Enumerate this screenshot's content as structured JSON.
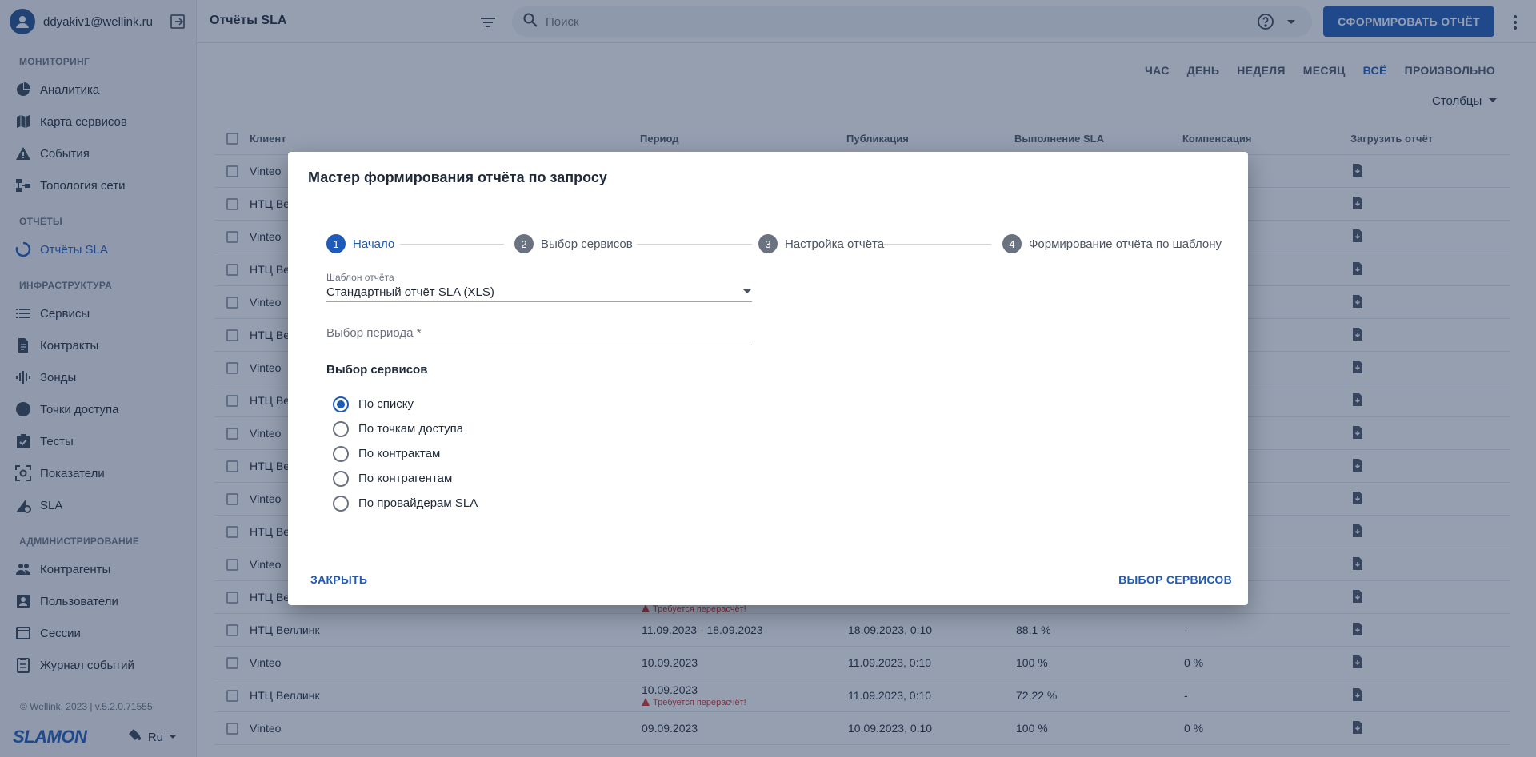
{
  "sidebar": {
    "user_email": "ddyakiv1@wellink.ru",
    "sections": {
      "monitoring": "МОНИТОРИНГ",
      "reports": "ОТЧЁТЫ",
      "infrastructure": "ИНФРАСТРУКТУРА",
      "administration": "АДМИНИСТРИРОВАНИЕ"
    },
    "items": {
      "analytics": "Аналитика",
      "service_map": "Карта сервисов",
      "events": "События",
      "topology": "Топология сети",
      "sla_reports": "Отчёты SLA",
      "services": "Сервисы",
      "contracts": "Контракты",
      "probes": "Зонды",
      "access_points": "Точки доступа",
      "tests": "Тесты",
      "indicators": "Показатели",
      "sla": "SLA",
      "counterparties": "Контрагенты",
      "users": "Пользователи",
      "sessions": "Сессии",
      "event_log": "Журнал событий"
    },
    "footer": "© Wellink, 2023 | v.5.2.0.71555",
    "logo": "SLAMON",
    "language": "Ru"
  },
  "header": {
    "title": "Отчёты SLA",
    "search_placeholder": "Поиск",
    "primary_button": "СФОРМИРОВАТЬ ОТЧЁТ"
  },
  "periods": [
    "ЧАС",
    "ДЕНЬ",
    "НЕДЕЛЯ",
    "МЕСЯЦ",
    "ВСЁ",
    "ПРОИЗВОЛЬНО"
  ],
  "active_period": "ВСЁ",
  "columns_button": "Столбцы",
  "table": {
    "headers": {
      "client": "Клиент",
      "period": "Период",
      "publication": "Публикация",
      "sla": "Выполнение SLA",
      "compensation": "Компенсация",
      "download": "Загрузить отчёт"
    },
    "hidden_rows": [
      "Vinteo",
      "НТЦ Ве",
      "Vinteo",
      "НТЦ Ве",
      "Vinteo",
      "НТЦ Ве",
      "Vinteo",
      "НТЦ Ве",
      "Vinteo",
      "НТЦ Ве",
      "Vinteo",
      "НТЦ Ве",
      "Vinteo",
      "НТЦ Ве"
    ],
    "partial_warning": "Требуется перерасчёт!",
    "rows": [
      {
        "client": "НТЦ Веллинк",
        "period": "11.09.2023 - 18.09.2023",
        "warning": "",
        "publication": "18.09.2023, 0:10",
        "sla": "88,1 %",
        "compensation": "-"
      },
      {
        "client": "Vinteo",
        "period": "10.09.2023",
        "warning": "",
        "publication": "11.09.2023, 0:10",
        "sla": "100 %",
        "compensation": "0 %"
      },
      {
        "client": "НТЦ Веллинк",
        "period": "10.09.2023",
        "warning": "Требуется перерасчёт!",
        "publication": "11.09.2023, 0:10",
        "sla": "72,22 %",
        "compensation": "-"
      },
      {
        "client": "Vinteo",
        "period": "09.09.2023",
        "warning": "",
        "publication": "10.09.2023, 0:10",
        "sla": "100 %",
        "compensation": "0 %"
      }
    ]
  },
  "modal": {
    "title": "Мастер формирования отчёта по запросу",
    "steps": [
      {
        "num": "1",
        "label": "Начало"
      },
      {
        "num": "2",
        "label": "Выбор сервисов"
      },
      {
        "num": "3",
        "label": "Настройка отчёта"
      },
      {
        "num": "4",
        "label": "Формирование отчёта по шаблону"
      }
    ],
    "template_label": "Шаблон отчёта",
    "template_value": "Стандартный отчёт SLA (XLS)",
    "period_placeholder": "Выбор периода *",
    "services_title": "Выбор сервисов",
    "radio_options": [
      "По списку",
      "По точкам доступа",
      "По контрактам",
      "По контрагентам",
      "По провайдерам SLA"
    ],
    "selected_option": "По списку",
    "close_button": "ЗАКРЫТЬ",
    "next_button": "ВЫБОР СЕРВИСОВ"
  },
  "colors": {
    "accent": "#1e5bb8",
    "warning": "#d32f2f",
    "overlay": "#22375a"
  }
}
